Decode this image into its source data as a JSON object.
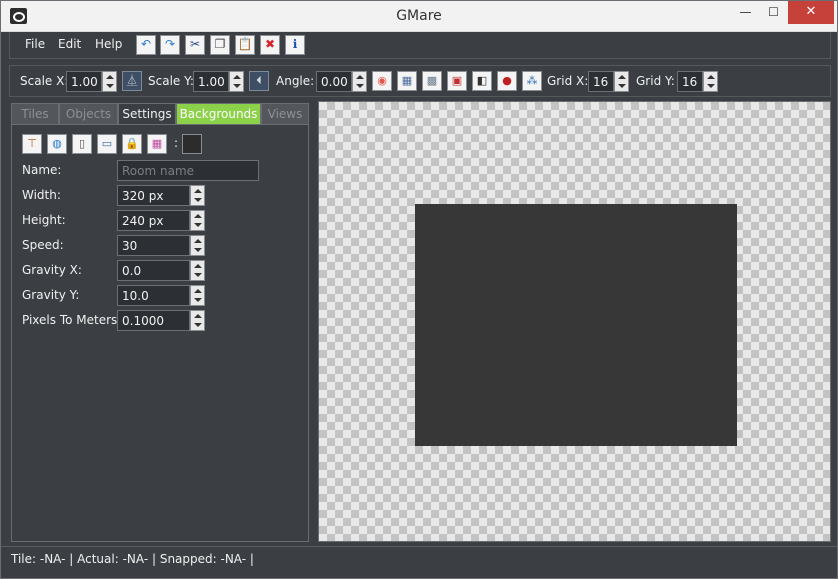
{
  "window": {
    "title": "GMare",
    "minimize_glyph": "—",
    "maximize_glyph": "☐",
    "close_glyph": "✕"
  },
  "menu": {
    "items": [
      "File",
      "Edit",
      "Help"
    ],
    "toolbar_icons": [
      {
        "name": "undo-icon",
        "glyph": "↶",
        "color": "#2f7ad1"
      },
      {
        "name": "redo-icon",
        "glyph": "↷",
        "color": "#2f7ad1"
      },
      {
        "name": "cut-icon",
        "glyph": "✂",
        "color": "#2b4a8a"
      },
      {
        "name": "copy-icon",
        "glyph": "❐",
        "color": "#444444"
      },
      {
        "name": "paste-icon",
        "glyph": "📋",
        "color": "#8a5a2b"
      },
      {
        "name": "delete-icon",
        "glyph": "✖",
        "color": "#d6262c"
      },
      {
        "name": "info-icon",
        "glyph": "ℹ",
        "color": "#1a4fb0"
      }
    ]
  },
  "transform_toolbar": {
    "scale_x_label": "Scale X:",
    "scale_x_value": "1.00",
    "scale_y_label": "Scale Y:",
    "scale_y_value": "1.00",
    "angle_label": "Angle:",
    "angle_value": "0.00",
    "grid_x_label": "Grid X:",
    "grid_x_value": "16",
    "grid_y_label": "Grid Y:",
    "grid_y_value": "16",
    "icons": [
      {
        "name": "color-wheel-icon",
        "glyph": "◉",
        "color": "#e2554a"
      },
      {
        "name": "grid-icon",
        "glyph": "▦",
        "color": "#4a6a9a"
      },
      {
        "name": "dotted-grid-icon",
        "glyph": "▩",
        "color": "#6a7a8a"
      },
      {
        "name": "tile-select-icon",
        "glyph": "▣",
        "color": "#c03030"
      },
      {
        "name": "layer-icon",
        "glyph": "◧",
        "color": "#333333"
      },
      {
        "name": "instance-icon",
        "glyph": "●",
        "color": "#c02020"
      },
      {
        "name": "objects-icon",
        "glyph": "⁂",
        "color": "#2a6ab0"
      }
    ],
    "flip_h_glyph": "⏅",
    "flip_v_glyph": "⏴"
  },
  "left_panel": {
    "tabs": [
      "Tiles",
      "Objects",
      "Settings",
      "Backgrounds",
      "Views"
    ],
    "active_tab": "Settings",
    "icon_row": [
      {
        "name": "ruler-icon",
        "glyph": "⊤",
        "color": "#c05a1a"
      },
      {
        "name": "globe-icon",
        "glyph": "◍",
        "color": "#2a7ad0"
      },
      {
        "name": "script-icon",
        "glyph": "▯",
        "color": "#555555"
      },
      {
        "name": "monitor-icon",
        "glyph": "▭",
        "color": "#3a6aaa"
      },
      {
        "name": "lock-icon",
        "glyph": "🔒",
        "color": "#555555"
      },
      {
        "name": "palette-icon",
        "glyph": "▦",
        "color": "#c04aa0"
      }
    ],
    "color_separator": ":",
    "color_swatch": "#2c2c2c",
    "fields": {
      "name_label": "Name:",
      "name_placeholder": "Room name",
      "width_label": "Width:",
      "width_value": "320 px",
      "height_label": "Height:",
      "height_value": "240 px",
      "speed_label": "Speed:",
      "speed_value": "30",
      "gravity_x_label": "Gravity X:",
      "gravity_x_value": "0.0",
      "gravity_y_label": "Gravity Y:",
      "gravity_y_value": "10.0",
      "ptm_label": "Pixels To Meters:",
      "ptm_value": "0.1000"
    }
  },
  "status": {
    "text": "Tile: -NA- | Actual: -NA- | Snapped: -NA- |"
  }
}
